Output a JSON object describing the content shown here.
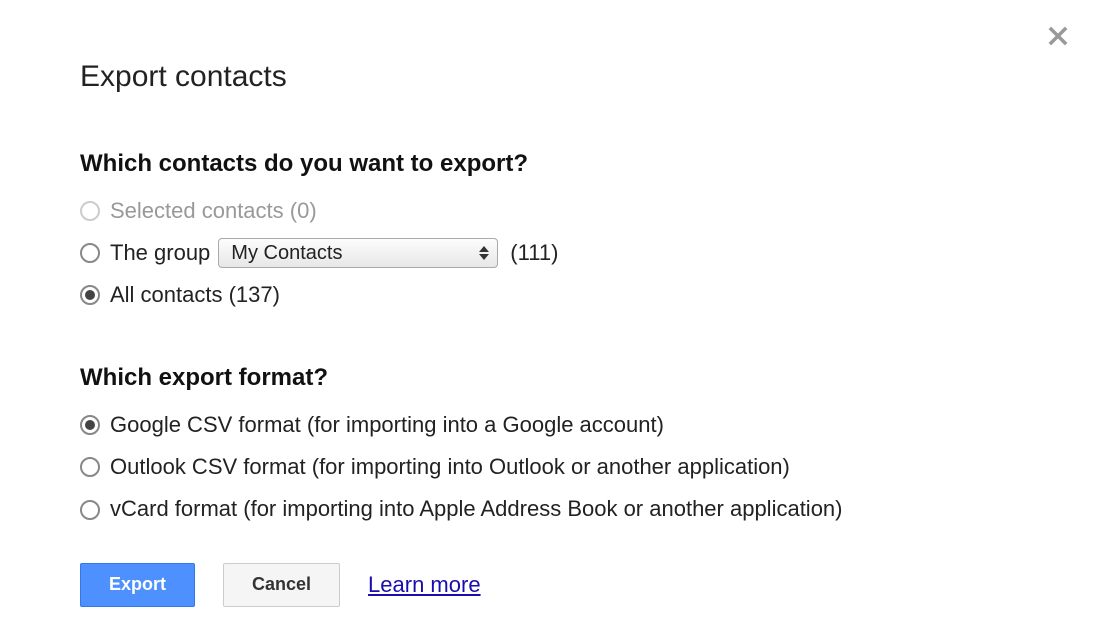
{
  "dialog": {
    "title": "Export contacts"
  },
  "contacts_section": {
    "heading": "Which contacts do you want to export?",
    "selected_label": "Selected contacts (0)",
    "group_label_prefix": "The group",
    "group_select_value": "My Contacts",
    "group_count": "(111)",
    "all_label": "All contacts (137)"
  },
  "format_section": {
    "heading": "Which export format?",
    "google_csv": "Google CSV format (for importing into a Google account)",
    "outlook_csv": "Outlook CSV format (for importing into Outlook or another application)",
    "vcard": "vCard format (for importing into Apple Address Book or another application)"
  },
  "buttons": {
    "export": "Export",
    "cancel": "Cancel",
    "learn_more": "Learn more"
  }
}
